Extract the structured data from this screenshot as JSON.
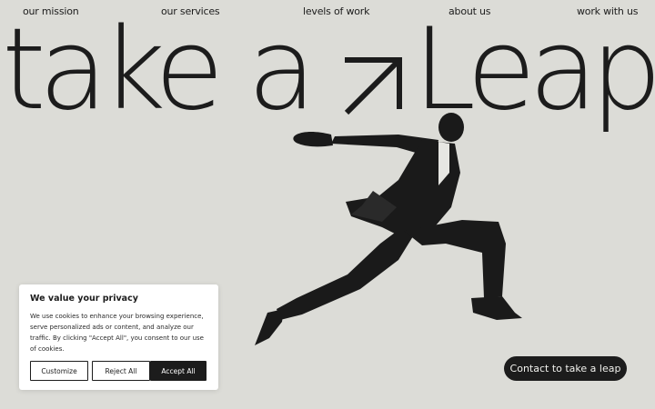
{
  "nav": {
    "items": [
      {
        "label": "our mission"
      },
      {
        "label": "our services"
      },
      {
        "label": "levels of work"
      },
      {
        "label": "about us"
      },
      {
        "label": "work with us"
      }
    ]
  },
  "hero": {
    "word_1": "take",
    "word_2": "a",
    "word_3": "Leap",
    "arrow_icon": "arrow-up-right-icon",
    "image_subject": "man in suit leaping mid-air"
  },
  "cookie_banner": {
    "title": "We value your privacy",
    "text": "We use cookies to enhance your browsing experience, serve personalized ads or content, and analyze our traffic. By clicking \"Accept All\", you consent to our use of cookies.",
    "customize_label": "Customize",
    "reject_label": "Reject All",
    "accept_label": "Accept All"
  },
  "cta": {
    "contact_label": "Contact to take a leap"
  },
  "colors": {
    "background": "#dcdcd7",
    "text": "#1c1c1c",
    "button_dark": "#1c1c1c",
    "button_light_text": "#f2f2ee"
  }
}
